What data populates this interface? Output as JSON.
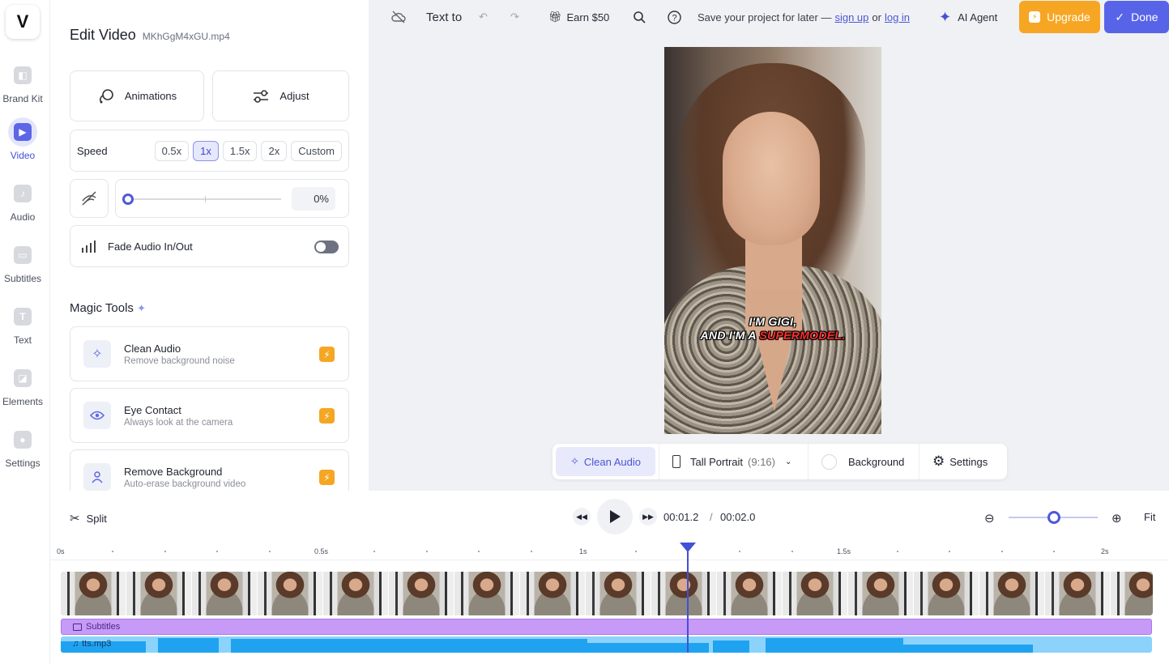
{
  "rail": {
    "logo": "V",
    "items": [
      {
        "label": "Brand Kit",
        "icon": "brand-kit-icon"
      },
      {
        "label": "Video",
        "icon": "video-icon"
      },
      {
        "label": "Audio",
        "icon": "music-note-icon"
      },
      {
        "label": "Subtitles",
        "icon": "subtitles-icon"
      },
      {
        "label": "Text",
        "icon": "text-icon"
      },
      {
        "label": "Elements",
        "icon": "elements-icon"
      },
      {
        "label": "Settings",
        "icon": "settings-icon"
      }
    ]
  },
  "panel": {
    "title": "Edit Video",
    "filename": "MKhGgM4xGU.mp4",
    "animations_label": "Animations",
    "adjust_label": "Adjust",
    "speed": {
      "label": "Speed",
      "options": [
        "0.5x",
        "1x",
        "1.5x",
        "2x",
        "Custom"
      ],
      "selected": "1x"
    },
    "volume_value": "0%",
    "fade_label": "Fade Audio In/Out",
    "magic_title": "Magic Tools",
    "tools": [
      {
        "title": "Clean Audio",
        "desc": "Remove background noise"
      },
      {
        "title": "Eye Contact",
        "desc": "Always look at the camera"
      },
      {
        "title": "Remove Background",
        "desc": "Auto-erase background video"
      }
    ]
  },
  "topbar": {
    "project_name": "Text to",
    "earn": "Earn $50",
    "save_text": "Save your project for later —",
    "sign_up": "sign up",
    "or": "or",
    "log_in": "log in",
    "ai_agent": "AI Agent",
    "upgrade": "Upgrade",
    "done": "Done"
  },
  "video": {
    "subtitle_line1": "I'M GIGI,",
    "subtitle_line2a": "AND I'M A",
    "subtitle_line2b": "SUPERMODEL."
  },
  "video_bar": {
    "clean_audio": "Clean Audio",
    "aspect": "Tall Portrait",
    "aspect_ratio": "(9:16)",
    "background": "Background",
    "settings": "Settings"
  },
  "timeline": {
    "split": "Split",
    "current_time": "00:01.2",
    "separator": "/",
    "total_time": "00:02.0",
    "fit": "Fit",
    "ruler": [
      "0s",
      "0.5s",
      "1s",
      "1.5s",
      "2s"
    ],
    "subtitles_track": "Subtitles",
    "audio_track": "tts.mp3"
  },
  "colors": {
    "accent": "#5864e8",
    "upgrade": "#f7a623",
    "subtitle_track": "#c79af7",
    "audio_track": "#8bd3fb"
  }
}
